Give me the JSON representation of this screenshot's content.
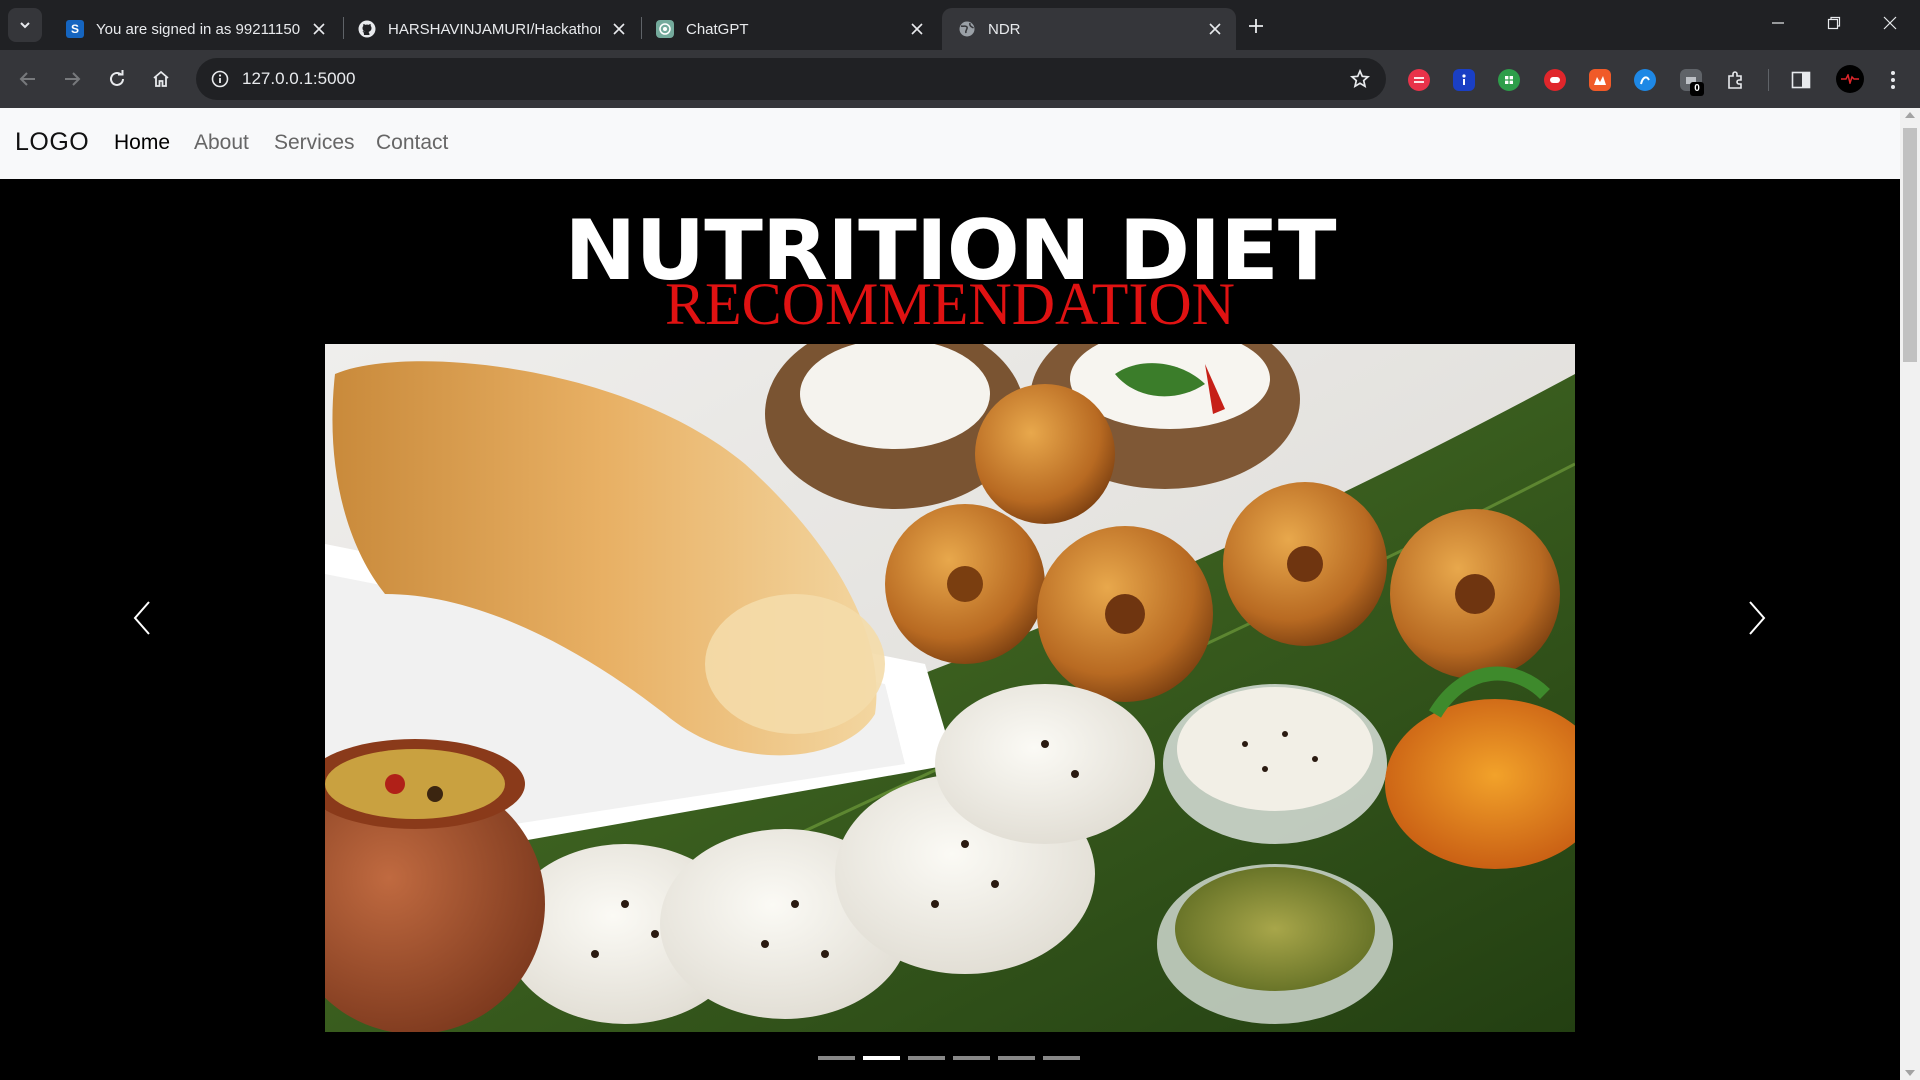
{
  "browser": {
    "tabs": [
      {
        "title": "You are signed in as 99211150",
        "favicon": "S",
        "favicon_color": "#1565c0",
        "active": false
      },
      {
        "title": "HARSHAVINJAMURI/Hackathon",
        "favicon": "github-icon",
        "favicon_color": "#202124",
        "active": false
      },
      {
        "title": "ChatGPT",
        "favicon": "chatgpt-icon",
        "favicon_color": "#74aa9c",
        "active": false
      },
      {
        "title": "NDR",
        "favicon": "globe-icon",
        "favicon_color": "#9aa0a6",
        "active": true
      }
    ],
    "url": "127.0.0.1:5000",
    "extension_badge": "0"
  },
  "navbar": {
    "logo": "LOGO",
    "links": [
      {
        "label": "Home",
        "active": true
      },
      {
        "label": "About",
        "active": false
      },
      {
        "label": "Services",
        "active": false
      },
      {
        "label": "Contact",
        "active": false
      }
    ]
  },
  "hero": {
    "title": "NUTRITION DIET",
    "subtitle": "RECOMMENDATION",
    "title_color": "#ffffff",
    "subtitle_color": "#e01212"
  },
  "carousel": {
    "image": "south-indian-breakfast-photo",
    "slides_count": 6,
    "active_slide": 2
  }
}
